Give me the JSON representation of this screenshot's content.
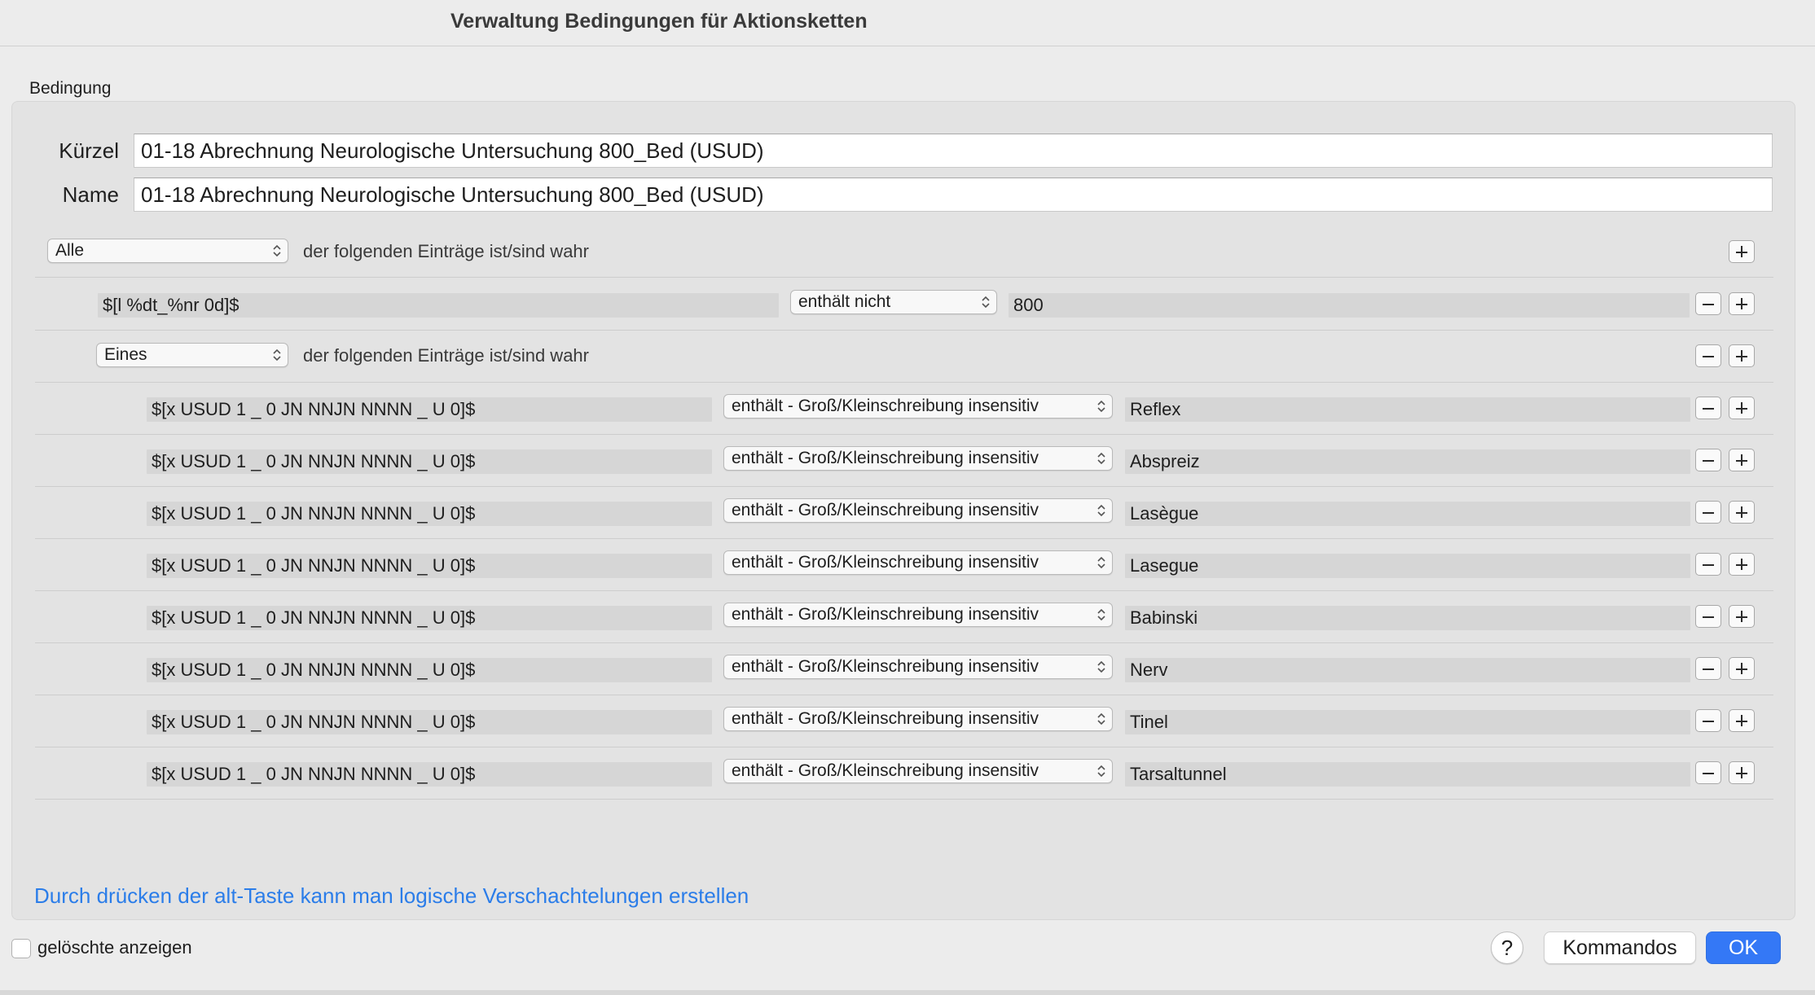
{
  "window": {
    "title": "Verwaltung Bedingungen für Aktionsketten"
  },
  "group": {
    "label": "Bedingung"
  },
  "fields": {
    "short_label": "Kürzel",
    "short_value": "01-18 Abrechnung Neurologische Untersuchung 800_Bed (USUD)",
    "name_label": "Name",
    "name_value": "01-18 Abrechnung Neurologische Untersuchung 800_Bed (USUD)"
  },
  "root": {
    "quantifier": "Alle",
    "text": "der folgenden Einträge ist/sind wahr"
  },
  "rule1": {
    "variable": "$[l %dt_%nr 0d]$",
    "operator": "enthält nicht",
    "value": "800"
  },
  "subgroup": {
    "quantifier": "Eines",
    "text": "der folgenden Einträge ist/sind wahr"
  },
  "subrules": [
    {
      "variable": "$[x USUD 1 _ 0 JN NNJN NNNN _ U 0]$",
      "operator": "enthält - Groß/Kleinschreibung insensitiv",
      "value": "Reflex"
    },
    {
      "variable": "$[x USUD 1 _ 0 JN NNJN NNNN _ U 0]$",
      "operator": "enthält - Groß/Kleinschreibung insensitiv",
      "value": "Abspreiz"
    },
    {
      "variable": "$[x USUD 1 _ 0 JN NNJN NNNN _ U 0]$",
      "operator": "enthält - Groß/Kleinschreibung insensitiv",
      "value": "Lasègue"
    },
    {
      "variable": "$[x USUD 1 _ 0 JN NNJN NNNN _ U 0]$",
      "operator": "enthält - Groß/Kleinschreibung insensitiv",
      "value": "Lasegue"
    },
    {
      "variable": "$[x USUD 1 _ 0 JN NNJN NNNN _ U 0]$",
      "operator": "enthält - Groß/Kleinschreibung insensitiv",
      "value": "Babinski"
    },
    {
      "variable": "$[x USUD 1 _ 0 JN NNJN NNNN _ U 0]$",
      "operator": "enthält - Groß/Kleinschreibung insensitiv",
      "value": "Nerv"
    },
    {
      "variable": "$[x USUD 1 _ 0 JN NNJN NNNN _ U 0]$",
      "operator": "enthält - Groß/Kleinschreibung insensitiv",
      "value": "Tinel"
    },
    {
      "variable": "$[x USUD 1 _ 0 JN NNJN NNNN _ U 0]$",
      "operator": "enthält - Groß/Kleinschreibung insensitiv",
      "value": "Tarsaltunnel"
    }
  ],
  "hint": "Durch drücken der alt-Taste kann man logische Verschachtelungen erstellen",
  "footer": {
    "show_deleted_label": "gelöschte anzeigen",
    "show_deleted_checked": false,
    "help_label": "?",
    "commands_label": "Kommandos",
    "ok_label": "OK"
  },
  "colors": {
    "accent": "#3478f6",
    "hint_text": "#2b7de9"
  },
  "icons": {
    "popup_arrows": "up-down-chevron-icon",
    "add": "plus-icon",
    "remove": "minus-icon",
    "help": "question-mark-icon"
  }
}
